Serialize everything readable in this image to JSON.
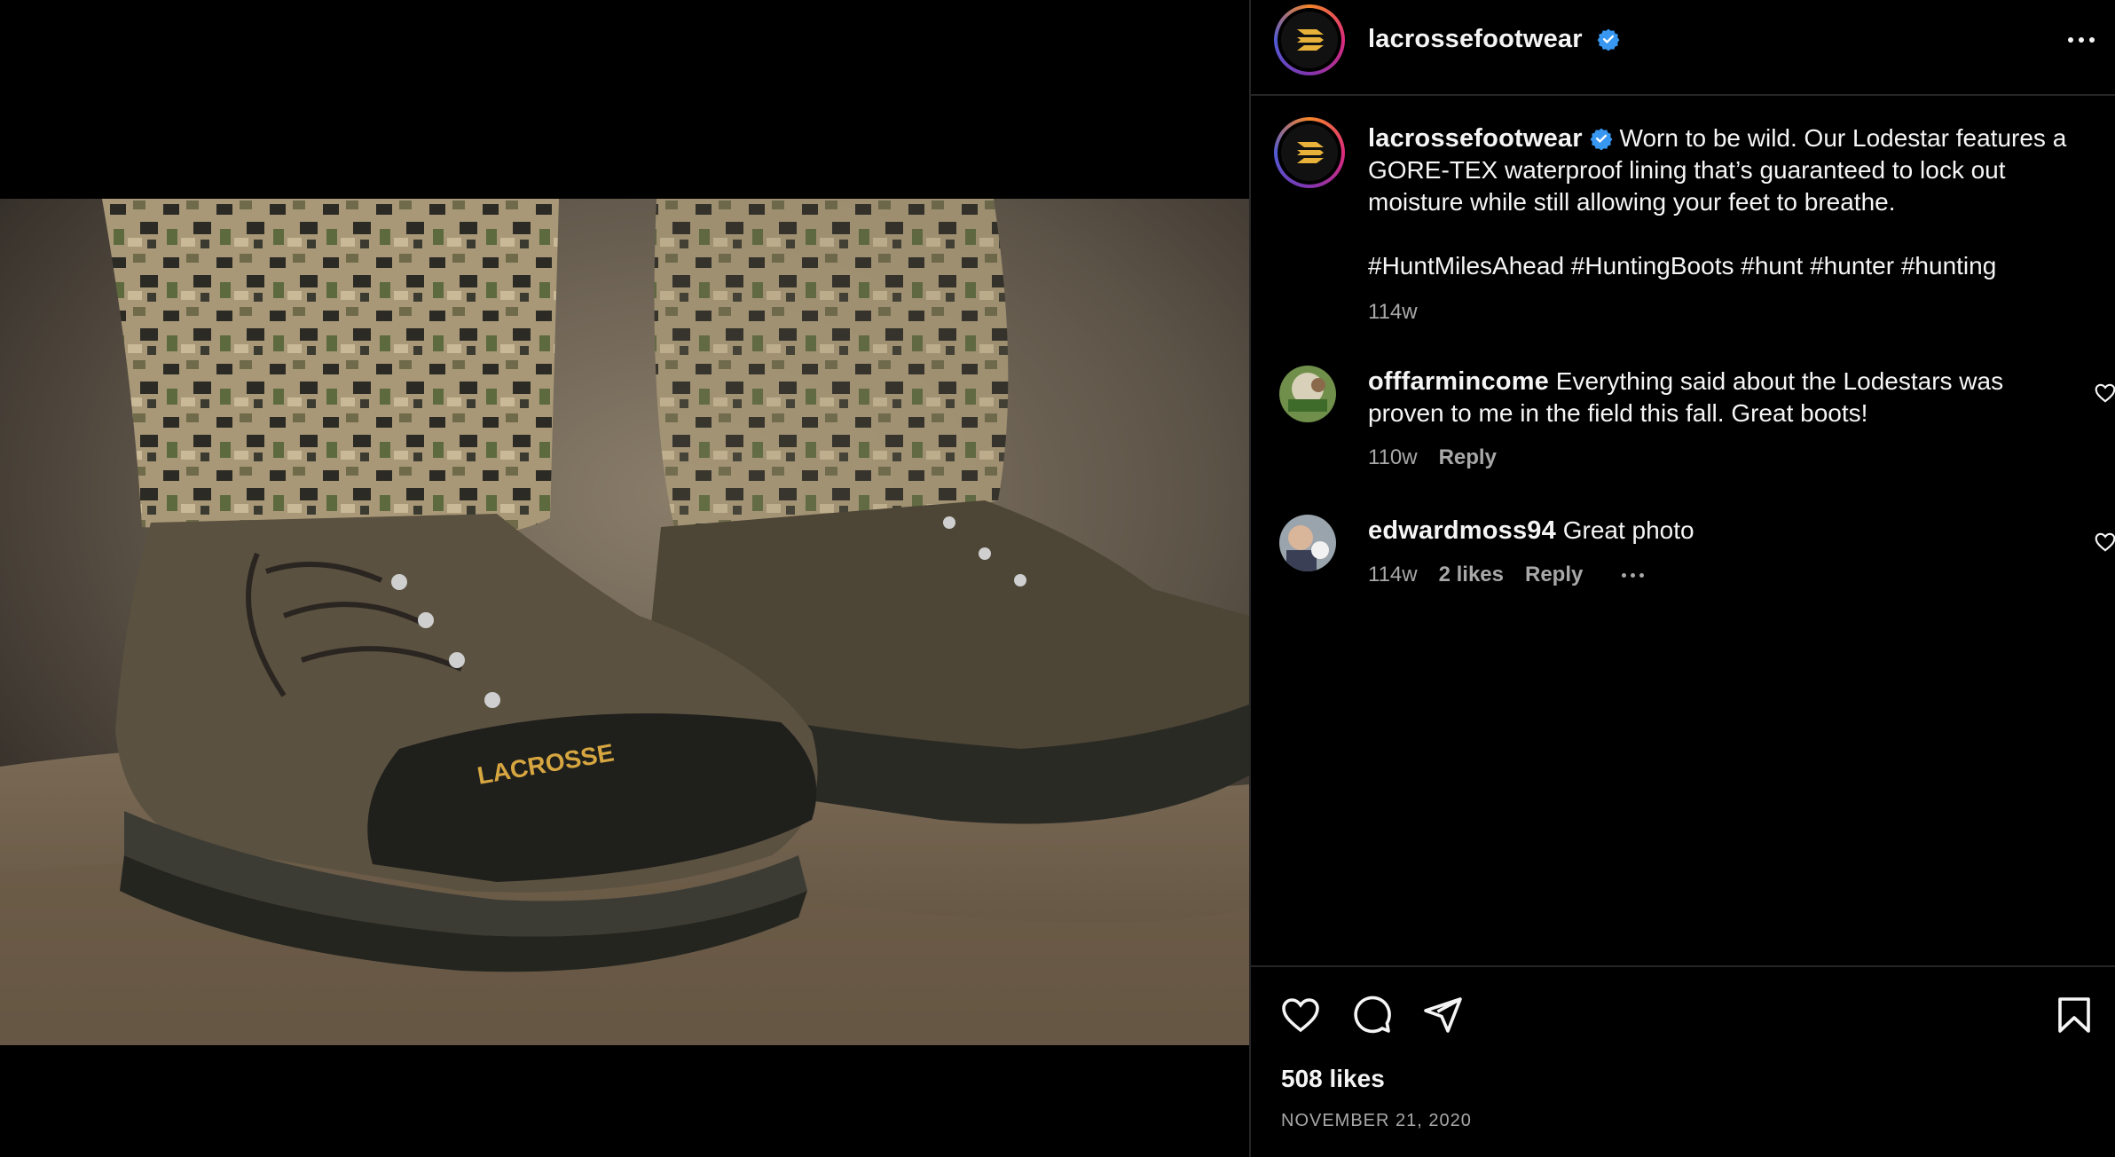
{
  "post": {
    "author": "lacrossefootwear",
    "brand_colors": {
      "gold": "#e8b23a",
      "ring": "#dd2a7b",
      "verified": "#3897f0"
    },
    "photo_alt_icon": "boot-photo",
    "photo_logo_text": "LACROSSE"
  },
  "caption": {
    "username": "lacrossefootwear",
    "text": "Worn to be wild. Our Lodestar features a GORE-TEX waterproof lining that’s guaranteed to lock out moisture while still allowing your feet to breathe.",
    "hashtags": "#HuntMilesAhead #HuntingBoots #hunt #hunter #hunting",
    "time": "114w"
  },
  "comments": [
    {
      "username": "offfarmincome",
      "text": "Everything said about the Lodestars was proven to me in the field this fall. Great boots!",
      "time": "110w",
      "reply_label": "Reply"
    },
    {
      "username": "edwardmoss94",
      "text": "Great photo",
      "time": "114w",
      "likes_label": "2 likes",
      "reply_label": "Reply"
    }
  ],
  "footer": {
    "likes": "508 likes",
    "date": "NOVEMBER 21, 2020"
  },
  "icons": [
    "heart-icon",
    "comment-icon",
    "share-icon",
    "bookmark-icon",
    "more-icon",
    "verified-icon"
  ]
}
